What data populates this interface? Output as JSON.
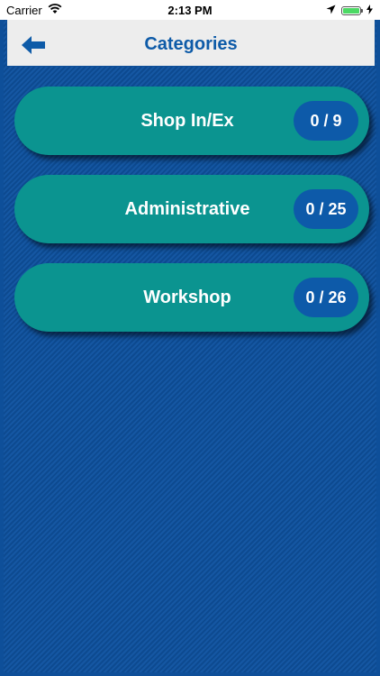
{
  "status_bar": {
    "carrier": "Carrier",
    "time": "2:13 PM",
    "battery_level": 1.0
  },
  "navbar": {
    "title": "Categories",
    "back_icon": "arrow-left-icon"
  },
  "categories": [
    {
      "label": "Shop In/Ex",
      "count": "0 / 9"
    },
    {
      "label": "Administrative",
      "count": "0 / 25"
    },
    {
      "label": "Workshop",
      "count": "0 / 26"
    }
  ],
  "colors": {
    "primary_blue": "#0e4f99",
    "teal": "#0b9490",
    "title_blue": "#0e5ba8",
    "count_blue": "#0d5aa9"
  }
}
